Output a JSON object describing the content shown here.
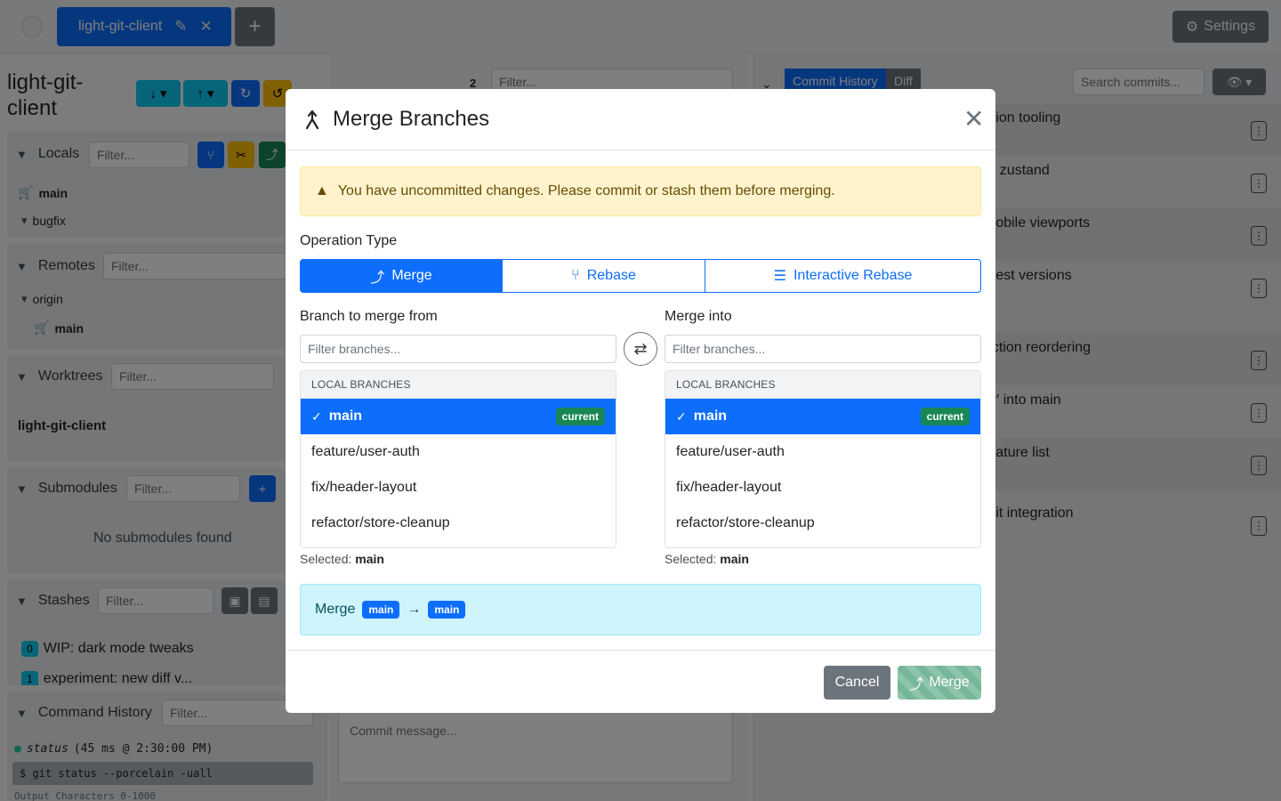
{
  "topbar": {
    "repo_tab_label": "light-git-client",
    "add_tab_label": "+",
    "settings_label": "Settings"
  },
  "sidebar": {
    "repo_title": "light-git-client",
    "locals": {
      "title": "Locals",
      "filter_placeholder": "Filter...",
      "items": [
        "main",
        "bugfix"
      ]
    },
    "remotes": {
      "title": "Remotes",
      "filter_placeholder": "Filter...",
      "items": [
        "origin",
        "main"
      ]
    },
    "worktrees": {
      "title": "Worktrees",
      "filter_placeholder": "Filter...",
      "items": [
        "light-git-client"
      ]
    },
    "submodules": {
      "title": "Submodules",
      "filter_placeholder": "Filter...",
      "empty_text": "No submodules found"
    },
    "stashes": {
      "title": "Stashes",
      "filter_placeholder": "Filter...",
      "items": [
        {
          "index": "0",
          "label": "WIP: dark mode tweaks"
        },
        {
          "index": "1",
          "label": "experiment: new diff v..."
        }
      ]
    },
    "command_history": {
      "title": "Command History",
      "filter_placeholder": "Filter...",
      "entry_name": "status",
      "entry_meta": "(45 ms @ 2:30:00 PM)",
      "entry_command": "$ git status --porcelain -uall",
      "entry_output": "Output Characters 0-1000"
    }
  },
  "middle": {
    "count": "2",
    "filter_placeholder": "Filter...",
    "commit_placeholder": "Commit message..."
  },
  "right": {
    "tabs": [
      "Commit History",
      "Diff"
    ],
    "search_placeholder": "Search commits...",
    "history": [
      "ation tooling",
      "to zustand",
      "mobile viewports",
      "atest versions",
      "ection reordering",
      "er' into main",
      "feature list",
      "mit integration"
    ]
  },
  "modal": {
    "title": "Merge Branches",
    "alert_text": "You have uncommitted changes. Please commit or stash them before merging.",
    "operation_label": "Operation Type",
    "operations": [
      "Merge",
      "Rebase",
      "Interactive Rebase"
    ],
    "from_label": "Branch to merge from",
    "into_label": "Merge into",
    "filter_placeholder": "Filter branches...",
    "list_header": "LOCAL BRANCHES",
    "branches": [
      "main",
      "feature/user-auth",
      "fix/header-layout",
      "refactor/store-cleanup"
    ],
    "current_badge": "current",
    "selected_prefix": "Selected:",
    "selected_from": "main",
    "selected_into": "main",
    "summary_label": "Merge",
    "summary_from": "main",
    "summary_arrow": "→",
    "summary_into": "main",
    "cancel_label": "Cancel",
    "merge_label": "Merge"
  }
}
